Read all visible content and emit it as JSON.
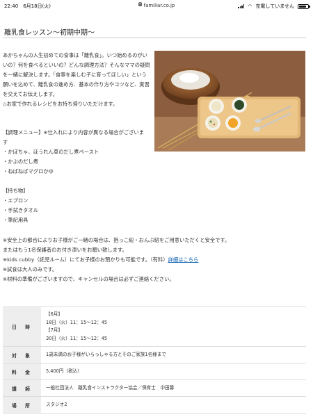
{
  "status_bar": {
    "time": "22:40",
    "date": "6月18日(火)",
    "url": "familiar.co.jp",
    "charging": "充電していません",
    "battery_level": 0.8
  },
  "page": {
    "title": "離乳食レッスン〜初期中期〜"
  },
  "intro": {
    "paragraphs": [
      "あかちゃんの人生初めての食事は「離乳食」。いつ始めるのがいいの？何を食べるといいの？どんな調理方法？そんなママの疑問を一緒に解決します。「食事を楽しむ子に育ってほしい」という願いを込めて、離乳食の進め方、基本の作り方やコツなど、実習を交えてお伝えします。",
      "◇お家で作れるレシピをお持ち帰りいただけます。"
    ]
  },
  "menu": {
    "heading": "【調理メニュー】※仕入れにより内容が異なる場合がございます",
    "items": [
      "・かぼちゃ、ほうれん草のだし煮ペースト",
      "・かぶのだし煮",
      "・ねばねばマグロかゆ"
    ]
  },
  "belongings": {
    "heading": "【持ち物】",
    "items": [
      "・エプロン",
      "・手拭きタオル",
      "・筆記用具"
    ]
  },
  "notes": {
    "line1": "※安全上の都合によりお子様がご一緒の場合は、抱っこ紐・おんぶ紐をご用意いただくと安全です。",
    "line2": "またはもう1名保護者のお付き添いをお願い致します。",
    "line3_prefix": "※kids cubby（託児ルーム）にてお子様のお預かりも可能です。（有料）",
    "line3_link": "詳細はこちら",
    "line4": "※試食は大人のみです。",
    "line5": "※材料の準備がございますので、キャンセルの場合は必ずご連絡ください。"
  },
  "info_table": {
    "rows": [
      {
        "label": "日　時",
        "lines": [
          "【6月】",
          "18日（火）11：15〜12：45",
          "【7月】",
          "30日（火）11：15〜12：45"
        ]
      },
      {
        "label": "対　象",
        "lines": [
          "1歳未満のお子様がいらっしゃる方とそのご家族1名様まで"
        ]
      },
      {
        "label": "料　金",
        "lines": [
          "5,400円（税込）"
        ]
      },
      {
        "label": "講　師",
        "lines": [
          "一般社団法人　離乳食インストラクター協会／保育士　中田馨"
        ]
      },
      {
        "label": "場　所",
        "lines": [
          "スタジオ2"
        ]
      }
    ]
  },
  "colors": {
    "link": "#0c5fb0",
    "header_cell": "#eeeeee"
  }
}
